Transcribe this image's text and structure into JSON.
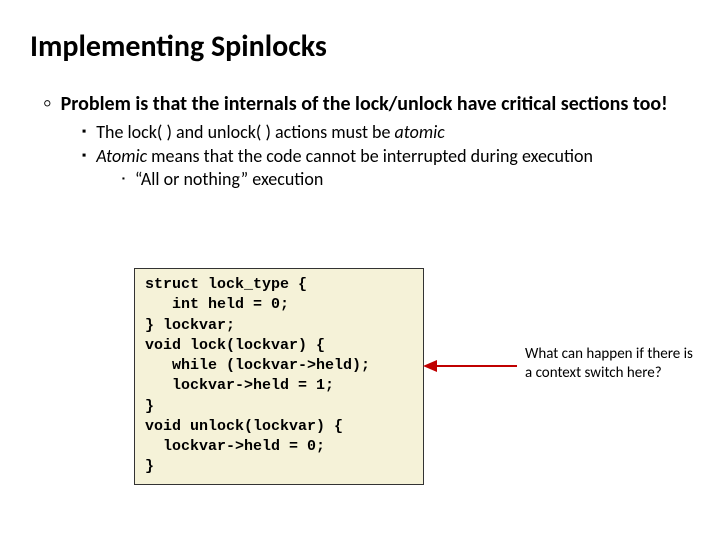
{
  "title": "Implementing Spinlocks",
  "lvl1_html": "Problem is that the internals of the lock/unlock have critical sections too!",
  "b1_html": "The lock( ) and unlock( ) actions must be <i>atomic</i>",
  "b2_html": "<i>Atomic</i> means that the code cannot be interrupted during execution",
  "b2a_html": "“All or nothing” execution",
  "code_lines": [
    "struct lock_type {",
    "   int held = 0;",
    "} lockvar;",
    "void lock(lockvar) {",
    "   while (lockvar->held);",
    "   lockvar->held = 1;",
    "}",
    "void unlock(lockvar) {",
    "  lockvar->held = 0;",
    "}"
  ],
  "arrow_color": "#c00000",
  "caption": "What can happen if there is a context switch here?",
  "chart_data": {
    "type": "table",
    "title": "Spinlock pseudocode",
    "values": [
      "struct lock_type { int held = 0; } lockvar;",
      "void lock(lockvar) { while (lockvar->held); lockvar->held = 1; }",
      "void unlock(lockvar) { lockvar->held = 0; }"
    ]
  }
}
